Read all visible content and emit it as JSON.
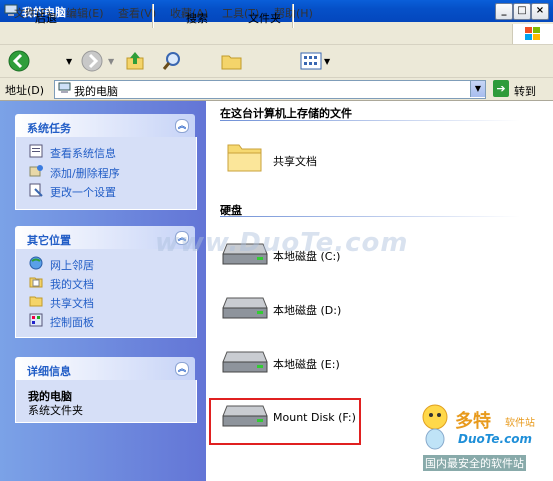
{
  "window": {
    "title": "我的电脑",
    "min": "_",
    "max": "□",
    "close": "×"
  },
  "menu": [
    "文件(F)",
    "编辑(E)",
    "查看(V)",
    "收藏(A)",
    "工具(T)",
    "帮助(H)"
  ],
  "toolbar": {
    "back": "后退",
    "search": "搜索",
    "folders": "文件夹"
  },
  "address": {
    "label": "地址(D)",
    "value": "我的电脑",
    "go": "转到"
  },
  "left": {
    "system_tasks": {
      "title": "系统任务",
      "items": [
        "查看系统信息",
        "添加/删除程序",
        "更改一个设置"
      ]
    },
    "other_places": {
      "title": "其它位置",
      "items": [
        "网上邻居",
        "我的文档",
        "共享文档",
        "控制面板"
      ]
    },
    "details": {
      "title": "详细信息",
      "name": "我的电脑",
      "desc": "系统文件夹"
    }
  },
  "content": {
    "group1": "在这台计算机上存储的文件",
    "shared": "共享文档",
    "group2": "硬盘",
    "drives": [
      "本地磁盘 (C:)",
      "本地磁盘 (D:)",
      "本地磁盘 (E:)",
      "Mount Disk (F:)"
    ]
  },
  "watermark": {
    "main": "www.DuoTe.com",
    "logo": "多特",
    "logo_sub": "软件站",
    "logo_url": "DuoTe.com",
    "tag": "国内最安全的软件站"
  }
}
